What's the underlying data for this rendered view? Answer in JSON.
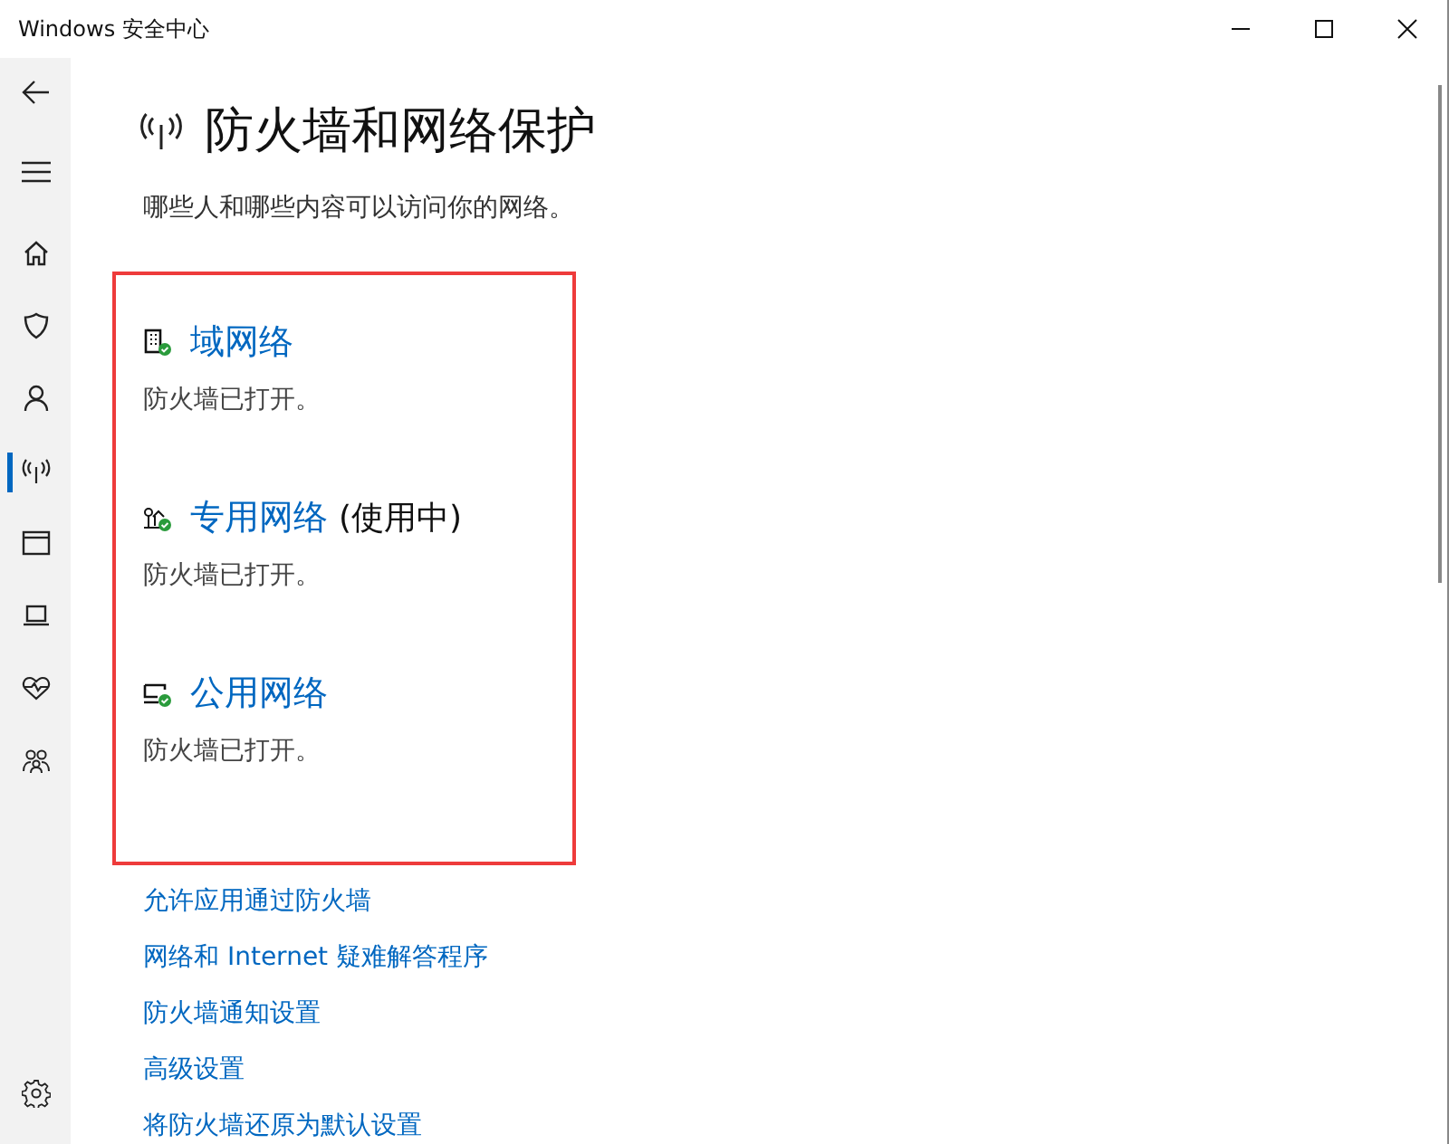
{
  "window": {
    "title": "Windows 安全中心"
  },
  "sidebar": {
    "items": [
      {
        "kind": "back",
        "selected": false
      },
      {
        "kind": "menu",
        "selected": false
      },
      {
        "kind": "home",
        "selected": false
      },
      {
        "kind": "shield",
        "selected": false
      },
      {
        "kind": "person",
        "selected": false
      },
      {
        "kind": "antenna",
        "selected": true
      },
      {
        "kind": "browser",
        "selected": false
      },
      {
        "kind": "laptop",
        "selected": false
      },
      {
        "kind": "health",
        "selected": false
      },
      {
        "kind": "family",
        "selected": false
      }
    ],
    "bottom": [
      {
        "kind": "settings",
        "selected": false
      }
    ]
  },
  "page": {
    "title": "防火墙和网络保护",
    "subtitle": "哪些人和哪些内容可以访问你的网络。"
  },
  "networks": [
    {
      "kind": "domain",
      "name": "域网络",
      "status": "防火墙已打开。"
    },
    {
      "kind": "private",
      "name": "专用网络",
      "tag": "(使用中)",
      "status": "防火墙已打开。"
    },
    {
      "kind": "public",
      "name": "公用网络",
      "status": "防火墙已打开。"
    }
  ],
  "links": [
    "允许应用通过防火墙",
    "网络和 Internet 疑难解答程序",
    "防火墙通知设置",
    "高级设置",
    "将防火墙还原为默认设置"
  ]
}
